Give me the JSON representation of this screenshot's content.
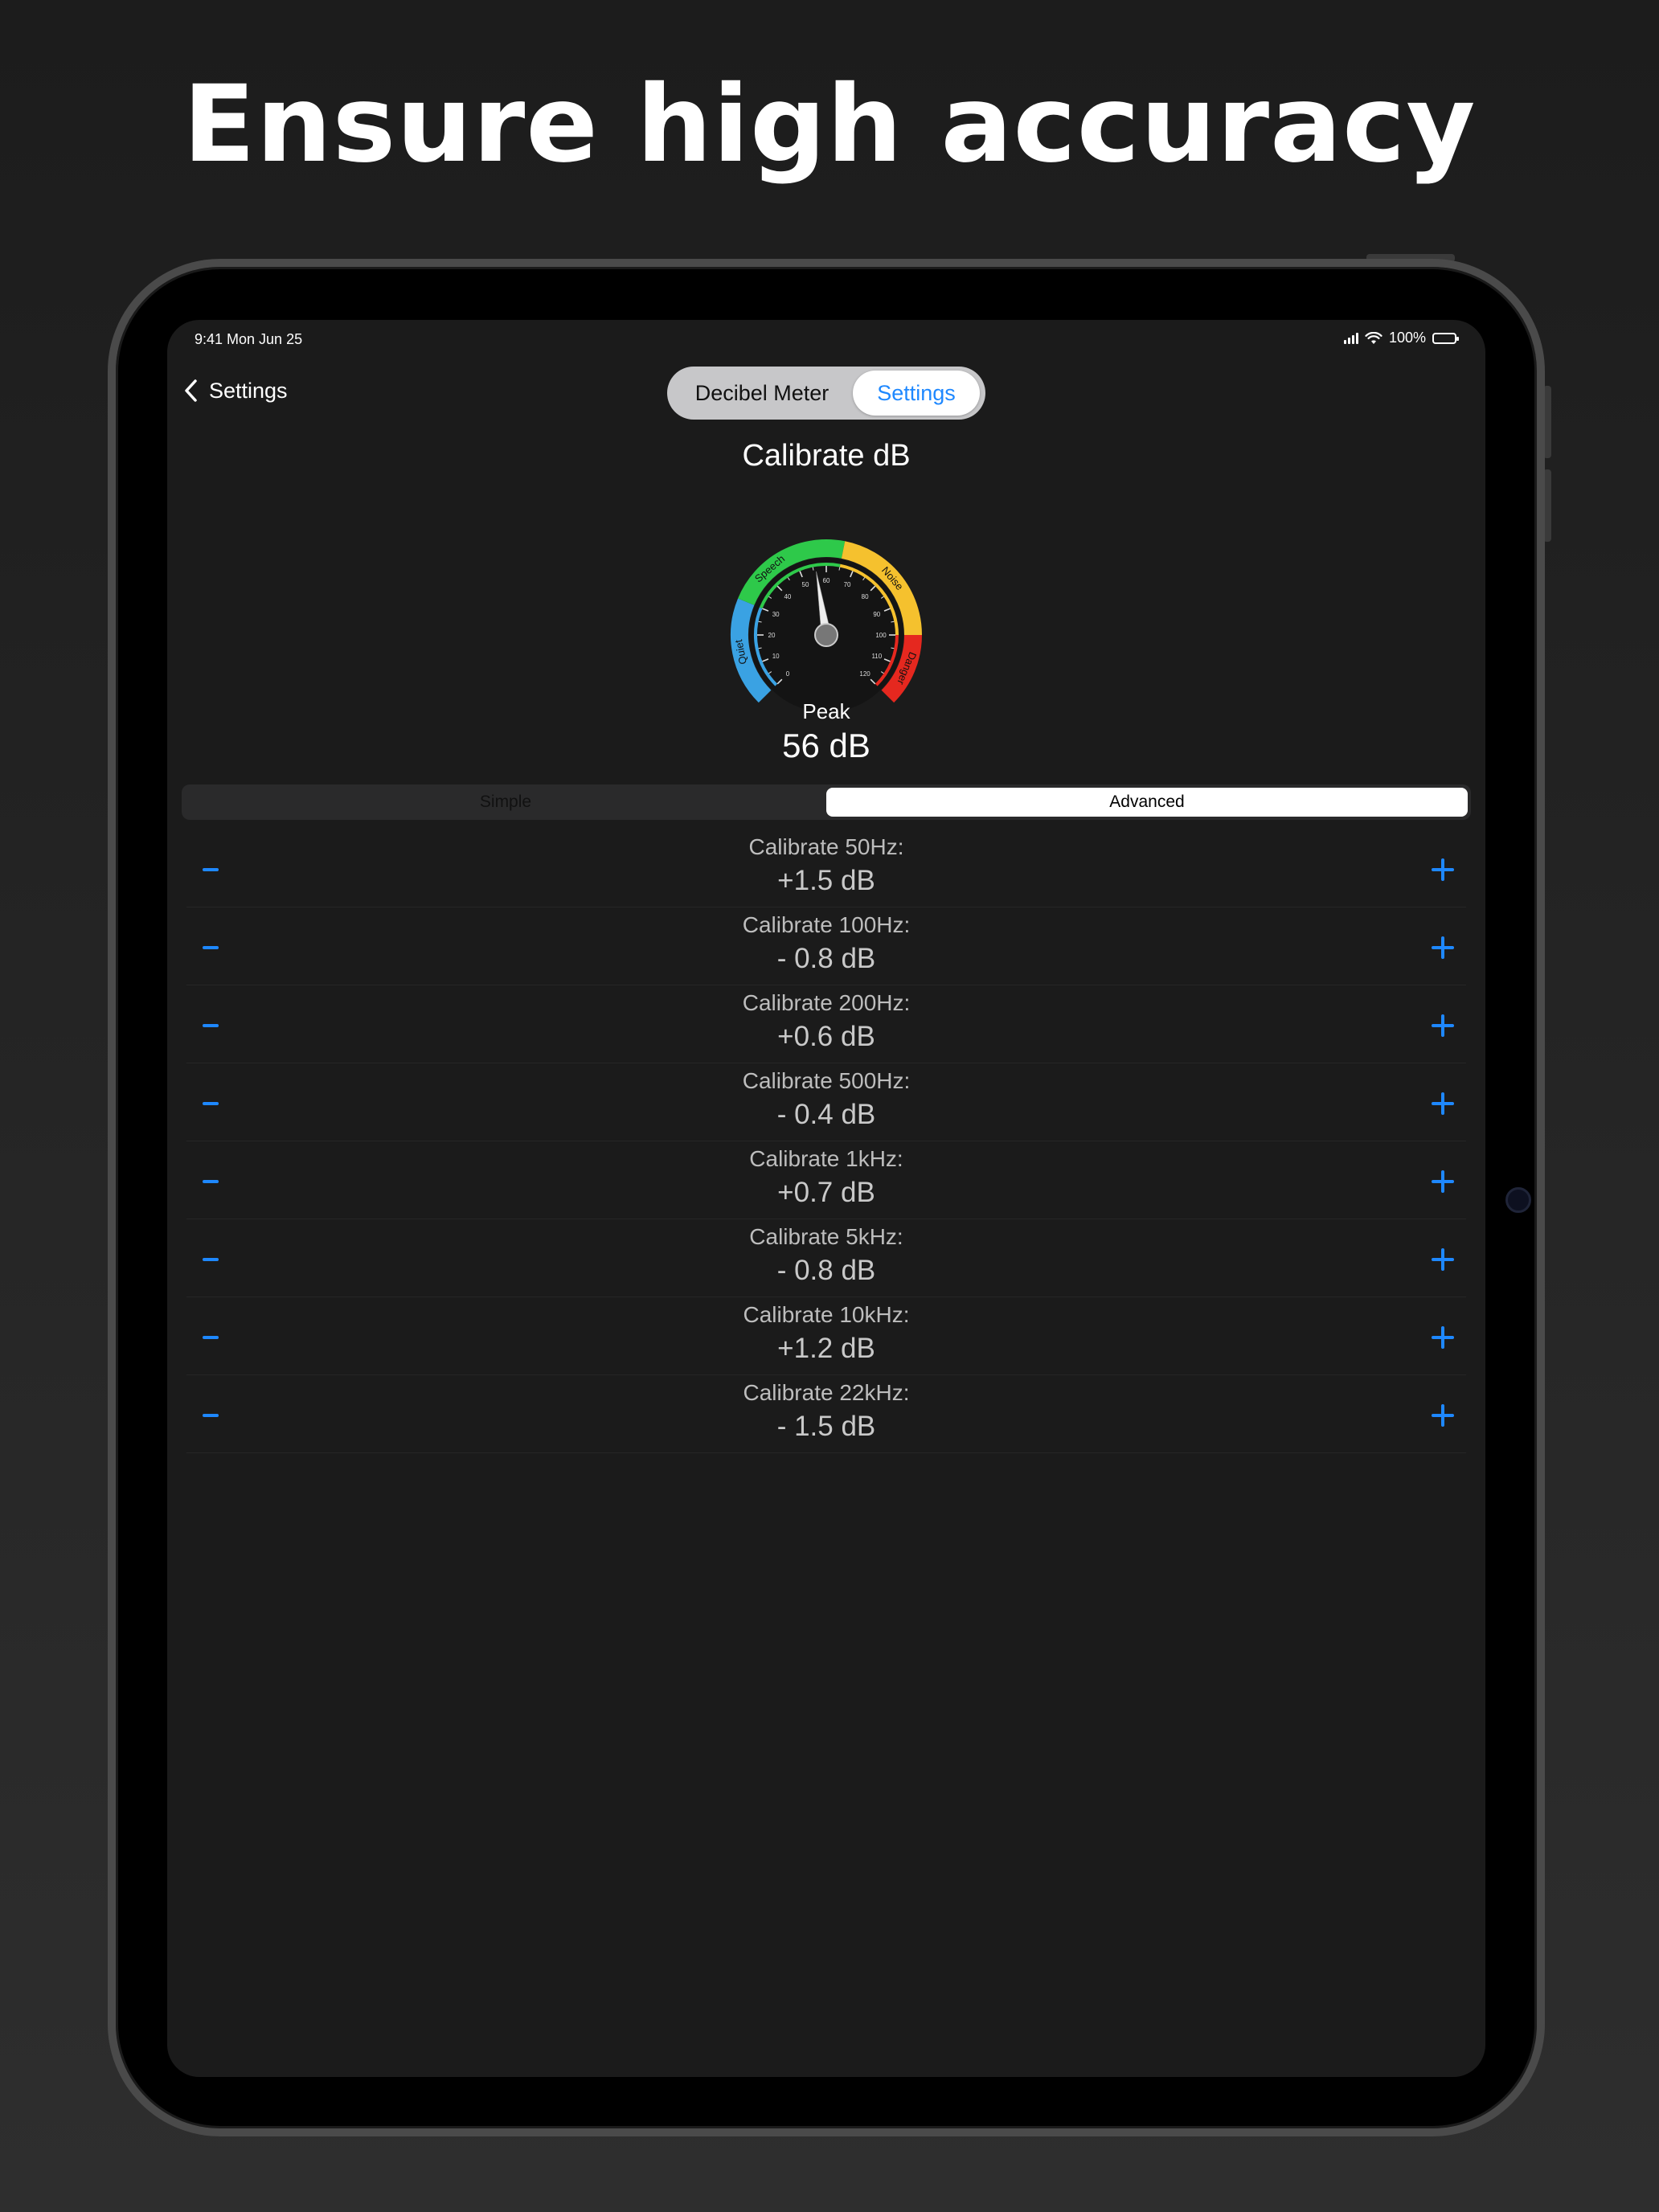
{
  "headline": "Ensure high accuracy",
  "status": {
    "time": "9:41  Mon Jun 25",
    "battery": "100%"
  },
  "nav": {
    "back_label": "Settings"
  },
  "top_tabs": {
    "meter": "Decibel Meter",
    "settings": "Settings"
  },
  "title": "Calibrate dB",
  "gauge": {
    "zones": [
      "Quiet",
      "Speech",
      "Noise",
      "Danger"
    ],
    "ticks": [
      "0",
      "10",
      "20",
      "30",
      "40",
      "50",
      "60",
      "70",
      "80",
      "90",
      "100",
      "110",
      "120"
    ],
    "needle_value": 56,
    "colors": {
      "quiet": "#3aa2e3",
      "speech": "#2ec94a",
      "noise": "#f5c12e",
      "danger": "#e5281f"
    }
  },
  "peak": {
    "label": "Peak",
    "value": "56 dB"
  },
  "mode": {
    "simple": "Simple",
    "advanced": "Advanced"
  },
  "calibrations": [
    {
      "label": "Calibrate 50Hz:",
      "value": "+1.5 dB"
    },
    {
      "label": "Calibrate 100Hz:",
      "value": "- 0.8 dB"
    },
    {
      "label": "Calibrate 200Hz:",
      "value": "+0.6 dB"
    },
    {
      "label": "Calibrate 500Hz:",
      "value": "- 0.4 dB"
    },
    {
      "label": "Calibrate 1kHz:",
      "value": "+0.7 dB"
    },
    {
      "label": "Calibrate 5kHz:",
      "value": "- 0.8 dB"
    },
    {
      "label": "Calibrate 10kHz:",
      "value": "+1.2 dB"
    },
    {
      "label": "Calibrate 22kHz:",
      "value": "- 1.5 dB"
    }
  ],
  "accent": "#1e88ff"
}
